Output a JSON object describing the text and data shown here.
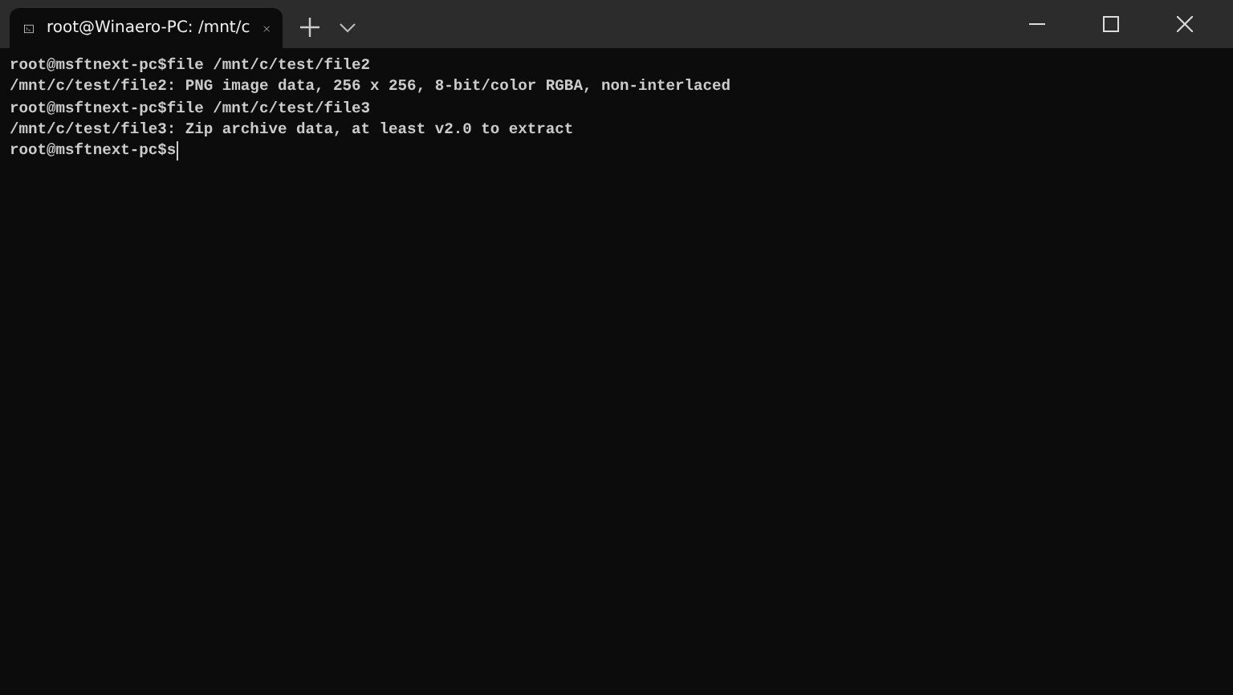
{
  "tabs": [
    {
      "title": "root@Winaero-PC: /mnt/c",
      "selected": true
    }
  ],
  "terminal": {
    "lines": [
      "root@msftnext-pc$file /mnt/c/test/file2",
      "/mnt/c/test/file2: PNG image data, 256 x 256, 8-bit/color RGBA, non-interlaced",
      "root@msftnext-pc$file /mnt/c/test/file3",
      "/mnt/c/test/file3: Zip archive data, at least v2.0 to extract",
      "root@msftnext-pc$s"
    ]
  }
}
